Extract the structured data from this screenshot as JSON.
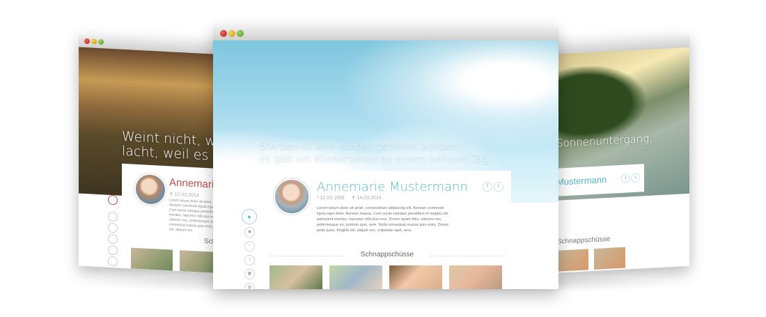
{
  "left_window": {
    "quote": "Weint nicht, weil ich\nlacht, weil es schön",
    "name": "Annemarie Mustermann",
    "date": "✝ 12.03.2014",
    "lorem": "Lorem ipsum dolor sit amet, consectetuer adipiscing elit. Aenean commodo ligula eget dolor. Aenean massa. Cum sociis natoque penatibus et magnis dis parturient montes, nascetur ridiculus mus. Donec quam felis, ultricies nec, pellentesque eu, pretium quis, sem. Nulla consequat massa quis enim. Donec pede justo, fringilla vel, aliquet nec.",
    "snap_title": "Schnappschüsse"
  },
  "right_window": {
    "quote": "Sonnenuntergang,",
    "name": "Mustermann",
    "snap_title": "Schnappschüsse"
  },
  "center_window": {
    "quote_line1": "Sterben ist kein ewiges getrennt werden;",
    "quote_line2": "es gibt ein Wiedersehen an einem helleren Tag.",
    "name": "Annemarie Mustermann",
    "birth": "* 12.03.1956",
    "death": "✝ 14.03.2014",
    "lorem": "Lorem ipsum dolor sit amet, consectetuer adipiscing elit. Aenean commodo ligula eget dolor. Aenean massa. Cum sociis natoque penatibus et magnis dis parturient montes, nascetur ridiculus mus. Donec quam felis, ultricies nec, pellentesque eu, pretium quis, sem. Nulla consequat massa quis enim. Donec pede justo, fringilla vel, aliquet nec, vulputate eget, arcu.",
    "snap_title": "Schnappschüsse",
    "social": {
      "facebook": "f",
      "twitter": "t"
    },
    "sidebar_icons": [
      "person-icon",
      "camera-icon",
      "document-icon",
      "info-icon",
      "calendar-icon",
      "flower-icon"
    ]
  },
  "colors": {
    "accent_blue": "#5bbad0",
    "accent_red": "#b9504d"
  }
}
